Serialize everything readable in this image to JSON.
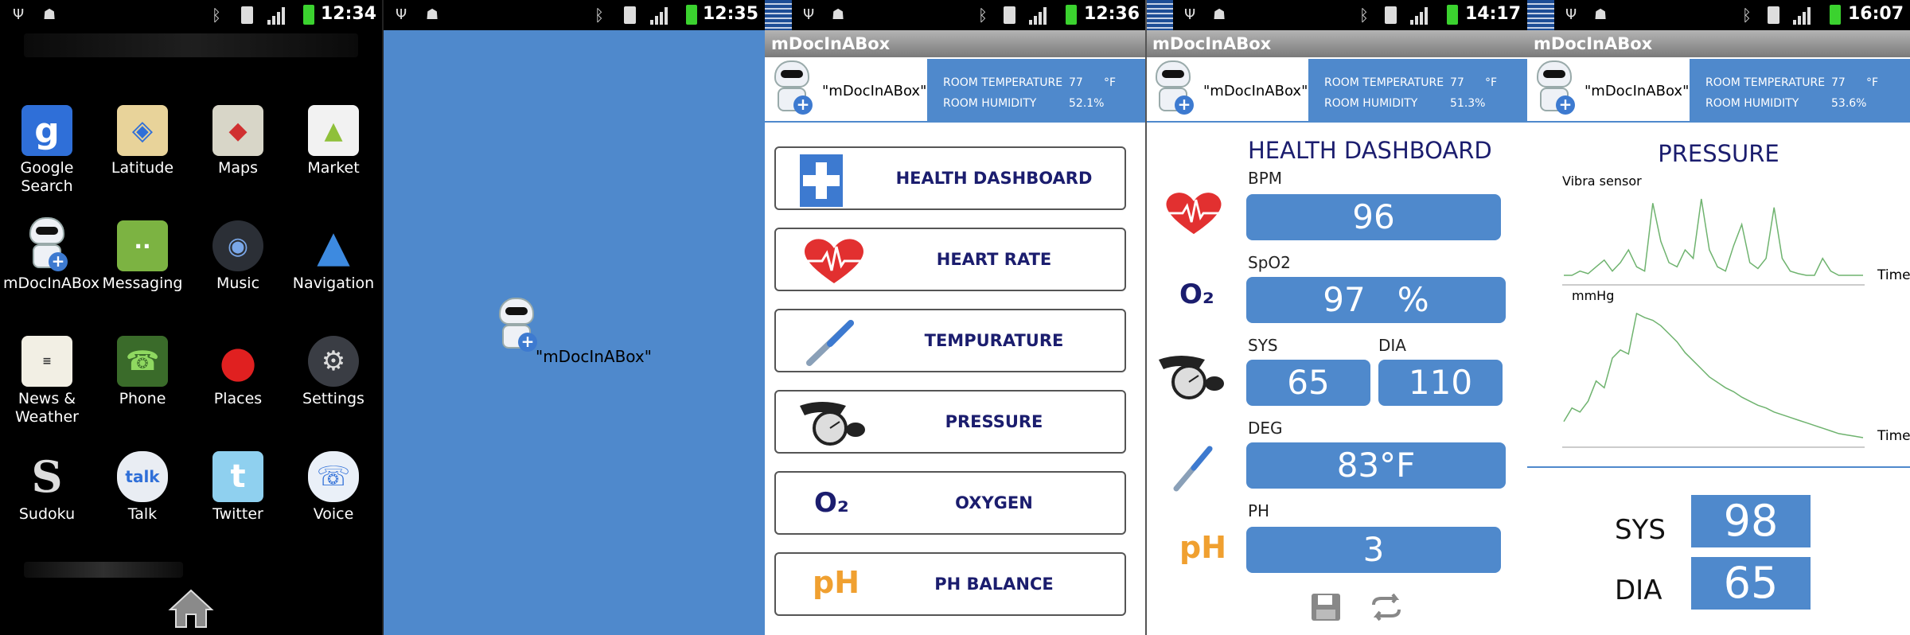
{
  "colors": {
    "accent": "#4f89cc",
    "navy_text": "#1b1d6e",
    "battery": "#3bd22f"
  },
  "statusbars": [
    {
      "time": "12:34"
    },
    {
      "time": "12:35"
    },
    {
      "time": "12:36"
    },
    {
      "time": "14:17"
    },
    {
      "time": "16:07"
    }
  ],
  "launcher": {
    "apps": [
      {
        "label": "Google Search",
        "icon": "google-search-icon"
      },
      {
        "label": "Latitude",
        "icon": "latitude-icon"
      },
      {
        "label": "Maps",
        "icon": "maps-icon"
      },
      {
        "label": "Market",
        "icon": "market-icon"
      },
      {
        "label": "mDocInABox",
        "icon": "robot-icon"
      },
      {
        "label": "Messaging",
        "icon": "messaging-icon"
      },
      {
        "label": "Music",
        "icon": "music-icon"
      },
      {
        "label": "Navigation",
        "icon": "navigation-icon"
      },
      {
        "label": "News & Weather",
        "icon": "news-icon"
      },
      {
        "label": "Phone",
        "icon": "phone-icon"
      },
      {
        "label": "Places",
        "icon": "places-icon"
      },
      {
        "label": "Settings",
        "icon": "settings-icon"
      },
      {
        "label": "Sudoku",
        "icon": "sudoku-icon"
      },
      {
        "label": "Talk",
        "icon": "talk-icon"
      },
      {
        "label": "Twitter",
        "icon": "twitter-icon"
      },
      {
        "label": "Voice",
        "icon": "voice-icon"
      }
    ],
    "icon_glyphs": {
      "google": "g",
      "talk": "talk",
      "sudoku": "S"
    }
  },
  "splash": {
    "logo_text": "\"mDocInABox\""
  },
  "app": {
    "title": "mDocInABox",
    "logo_text": "\"mDocInABox\"",
    "env_labels": {
      "temp": "ROOM TEMPERATURE",
      "humidity": "ROOM HUMIDITY",
      "temp_unit": "°F"
    }
  },
  "menu_screen": {
    "env": {
      "temp": "77",
      "humidity": "52.1%"
    },
    "buttons": [
      {
        "label": "HEALTH DASHBOARD",
        "icon": "plus-cross-icon"
      },
      {
        "label": "HEART RATE",
        "icon": "heart-rate-icon"
      },
      {
        "label": "TEMPURATURE",
        "icon": "thermometer-icon"
      },
      {
        "label": "PRESSURE",
        "icon": "blood-pressure-cuff-icon"
      },
      {
        "label": "OXYGEN",
        "icon": "oxygen-icon"
      },
      {
        "label": "PH BALANCE",
        "icon": "ph-icon"
      }
    ],
    "o2_glyph": "O₂",
    "ph_glyph": "pH"
  },
  "dashboard_screen": {
    "env": {
      "temp": "77",
      "humidity": "51.3%"
    },
    "title": "HEALTH DASHBOARD",
    "bpm_label": "BPM",
    "bpm_value": "96",
    "spo2_label": "SpO2",
    "spo2_value": "97   %",
    "sys_label": "SYS",
    "sys_value": "65",
    "dia_label": "DIA",
    "dia_value": "110",
    "deg_label": "DEG",
    "deg_value": "83°F",
    "ph_label": "PH",
    "ph_value": "3",
    "o2_glyph": "O₂",
    "ph_glyph": "pH",
    "toolbar": {
      "save_icon": "save-icon",
      "sync_icon": "sync-icon"
    }
  },
  "pressure_screen": {
    "env": {
      "temp": "77",
      "humidity": "53.6%"
    },
    "title": "PRESSURE",
    "chart1_label": "Vibra sensor",
    "chart1_axis": "Time",
    "chart2_label": "mmHg",
    "chart2_axis": "Time",
    "sys_label": "SYS",
    "sys_value": "98",
    "dia_label": "DIA",
    "dia_value": "65"
  },
  "chart_data": [
    {
      "type": "line",
      "title": "",
      "ylabel": "Vibra sensor",
      "xlabel": "Time",
      "grid": false,
      "series": [
        {
          "values": [
            0,
            0,
            0.05,
            0.02,
            0.1,
            0.18,
            0.05,
            0.15,
            0.3,
            0.1,
            0.05,
            0.85,
            0.4,
            0.15,
            0.1,
            0.3,
            0.2,
            0.9,
            0.3,
            0.1,
            0.05,
            0.35,
            0.6,
            0.15,
            0.08,
            0.2,
            0.8,
            0.2,
            0.05,
            0.02,
            0,
            0,
            0.2,
            0.05,
            0,
            0,
            0,
            0
          ]
        }
      ]
    },
    {
      "type": "line",
      "title": "",
      "ylabel": "mmHg",
      "xlabel": "Time",
      "grid": false,
      "series": [
        {
          "values": [
            0.15,
            0.25,
            0.22,
            0.3,
            0.45,
            0.4,
            0.62,
            0.68,
            0.65,
            0.95,
            0.92,
            0.9,
            0.86,
            0.8,
            0.74,
            0.66,
            0.6,
            0.54,
            0.48,
            0.44,
            0.4,
            0.37,
            0.33,
            0.3,
            0.27,
            0.25,
            0.22,
            0.2,
            0.18,
            0.16,
            0.14,
            0.12,
            0.1,
            0.08,
            0.06,
            0.05,
            0.04,
            0.03
          ]
        }
      ]
    }
  ]
}
